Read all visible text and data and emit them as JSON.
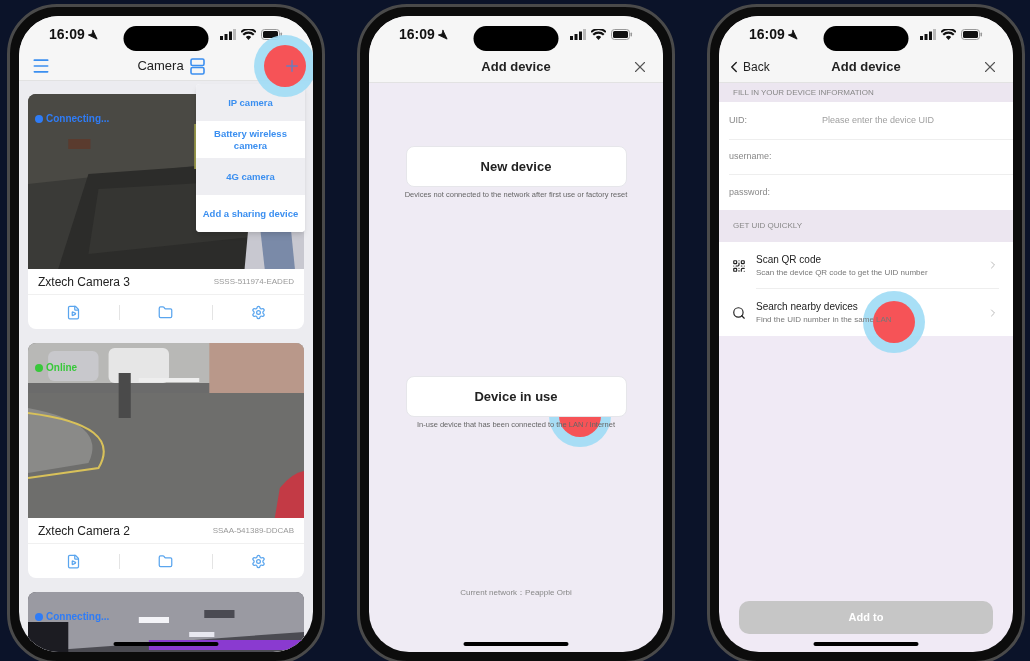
{
  "camera_list_screen": {
    "status_bar": {
      "time": "16:09"
    },
    "title": "Camera",
    "add_menu": [
      {
        "label": "IP camera",
        "highlighted": true
      },
      {
        "label": "Battery wireless camera",
        "highlighted": false
      },
      {
        "label": "4G camera",
        "highlighted": true
      },
      {
        "label": "Add a sharing device",
        "highlighted": false
      }
    ],
    "cameras": [
      {
        "name": "Zxtech Camera 3",
        "serial": "SSSS-511974-EADED",
        "status": "Connecting...",
        "color": "#2f7cf6",
        "kind": "picture"
      },
      {
        "name": "Zxtech Camera 2",
        "serial": "SSAA-541389-DDCAB",
        "status": "Online",
        "color": "#38c83a",
        "kind": "picture"
      },
      {
        "status": "Connecting...",
        "color": "#2f7cf6",
        "kind": "picture"
      }
    ]
  },
  "add_device_screen": {
    "status_bar": {
      "time": "16:09"
    },
    "title": "Add device",
    "options": [
      {
        "label": "New device",
        "caption": "Devices not connected to the network after first use or factory reset"
      },
      {
        "label": "Device in use",
        "caption": "In-use device that has been connected to the LAN / Internet"
      }
    ],
    "network": "Current network：Peapple Orbi"
  },
  "device_info_screen": {
    "status_bar": {
      "time": "16:09"
    },
    "back": "Back",
    "title": "Add device",
    "section_1": "FILL IN YOUR DEVICE INFORMATION",
    "fields": [
      {
        "label": "UID:",
        "placeholder": "Please enter the device UID"
      },
      {
        "label": "username:"
      },
      {
        "label": "password:"
      }
    ],
    "section_2": "GET UID QUICKLY",
    "methods": [
      {
        "kind": "qr",
        "title": "Scan QR code",
        "subtitle": "Scan the device QR code to get the UID number"
      },
      {
        "kind": "search",
        "title": "Search nearby devices",
        "subtitle": "Find the UID number in the same LAN"
      }
    ],
    "submit": {
      "label": "Add to",
      "disabled": true
    }
  }
}
